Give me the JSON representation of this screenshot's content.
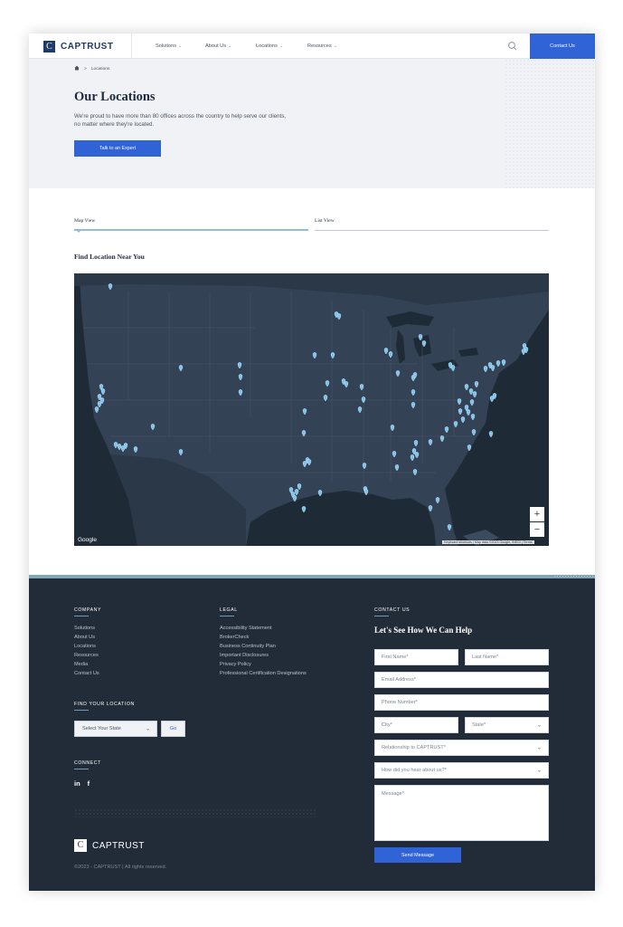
{
  "header": {
    "logo_mark": "C",
    "logo_text": "CAPTRUST",
    "nav": [
      {
        "label": "Solutions"
      },
      {
        "label": "About Us"
      },
      {
        "label": "Locations"
      },
      {
        "label": "Resources"
      }
    ],
    "chevron": "⌄",
    "contact_label": "Contact Us",
    "search_icon": "search-icon"
  },
  "hero": {
    "breadcrumb_home_icon": "home-icon",
    "breadcrumb_sep": ">",
    "breadcrumb_current": "Locations",
    "title": "Our Locations",
    "description": "We're proud to have more than 80 offices across the country to help serve our clients, no matter where they're located.",
    "cta_label": "Talk to an Expert"
  },
  "tabs": {
    "map_view": "Map View",
    "list_view": "List View",
    "active": "Map View"
  },
  "map": {
    "section_title": "Find Location Near You",
    "google_label": "Google",
    "attribution": "Keyboard shortcuts | Map data ©2023 Google, INEGI | Terms",
    "zoom_in": "+",
    "zoom_out": "−",
    "marker_color": "#7cc4ee",
    "land_color": "#334254",
    "water_color": "#1f2a37"
  },
  "footer": {
    "company": {
      "heading": "COMPANY",
      "links": [
        "Solutions",
        "About Us",
        "Locations",
        "Resources",
        "Media",
        "Contact Us"
      ]
    },
    "legal": {
      "heading": "LEGAL",
      "links": [
        "Accessibility Statement",
        "BrokerCheck",
        "Business Continuity Plan",
        "Important Disclosures",
        "Privacy Policy",
        "Professional Certification Designations"
      ]
    },
    "find_location": {
      "heading": "FIND YOUR LOCATION",
      "select_value": "Select Your State",
      "go_label": "Go"
    },
    "connect": {
      "heading": "CONNECT",
      "linkedin": "in",
      "facebook": "f"
    },
    "contact": {
      "heading": "CONTACT US",
      "title": "Let's See How We Can Help",
      "first_name": "First Name*",
      "last_name": "Last Name*",
      "email": "Email Address*",
      "phone": "Phone Number*",
      "city": "City*",
      "state": "State*",
      "relationship": "Relationship to CAPTRUST*",
      "hear_about": "How did you hear about us?*",
      "message": "Message*",
      "send_label": "Send Message"
    },
    "logo_mark": "C",
    "logo_text": "CAPTRUST",
    "copyright": "©2023 - CAPTRUST | All rights reserved."
  },
  "colors": {
    "brand_navy": "#1e3a66",
    "accent_blue": "#2f63d6",
    "footer_bg": "#222c38",
    "hero_bg": "#f0f2f5"
  }
}
